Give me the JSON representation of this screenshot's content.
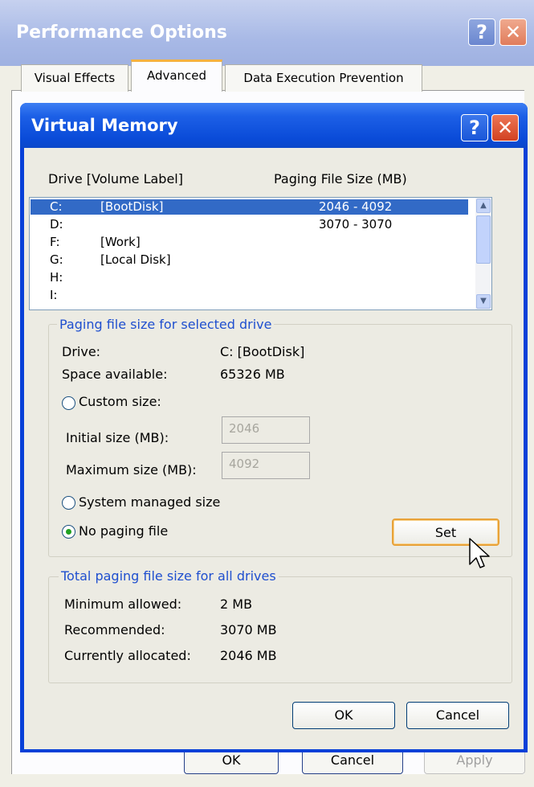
{
  "outer_window": {
    "title": "Performance Options",
    "help_glyph": "?",
    "close_glyph": "✕",
    "tabs": [
      "Visual Effects",
      "Advanced",
      "Data Execution Prevention"
    ],
    "selected_tab": "Advanced",
    "buttons": {
      "ok": "OK",
      "cancel": "Cancel",
      "apply": "Apply"
    }
  },
  "dialog": {
    "title": "Virtual Memory",
    "help_glyph": "?",
    "close_glyph": "✕",
    "list_header": {
      "drive": "Drive  [Volume Label]",
      "size": "Paging File Size (MB)"
    },
    "drives": [
      {
        "letter": "C:",
        "label": "[BootDisk]",
        "size": "2046 - 4092",
        "selected": true
      },
      {
        "letter": "D:",
        "label": "",
        "size": "3070 - 3070",
        "selected": false
      },
      {
        "letter": "F:",
        "label": "[Work]",
        "size": "",
        "selected": false
      },
      {
        "letter": "G:",
        "label": "[Local Disk]",
        "size": "",
        "selected": false
      },
      {
        "letter": "H:",
        "label": "",
        "size": "",
        "selected": false
      },
      {
        "letter": "I:",
        "label": "",
        "size": "",
        "selected": false
      }
    ],
    "selected_group": {
      "title": "Paging file size for selected drive",
      "drive_label": "Drive:",
      "drive_value": "C:  [BootDisk]",
      "space_label": "Space available:",
      "space_value": "65326 MB",
      "custom_size": "Custom size:",
      "initial_label": "Initial size (MB):",
      "initial_value": "2046",
      "maximum_label": "Maximum size (MB):",
      "maximum_value": "4092",
      "system_managed": "System managed size",
      "no_paging": "No paging file",
      "selected_option": "No paging file",
      "set_button": "Set"
    },
    "total_group": {
      "title": "Total paging file size for all drives",
      "min_label": "Minimum allowed:",
      "min_value": "2 MB",
      "rec_label": "Recommended:",
      "rec_value": "3070 MB",
      "cur_label": "Currently allocated:",
      "cur_value": "2046 MB"
    },
    "buttons": {
      "ok": "OK",
      "cancel": "Cancel"
    }
  },
  "colors": {
    "title_blue": "#0a4bd8",
    "selection": "#326ac6",
    "group_label": "#1f4fcf",
    "radio_dot": "#21a121"
  }
}
